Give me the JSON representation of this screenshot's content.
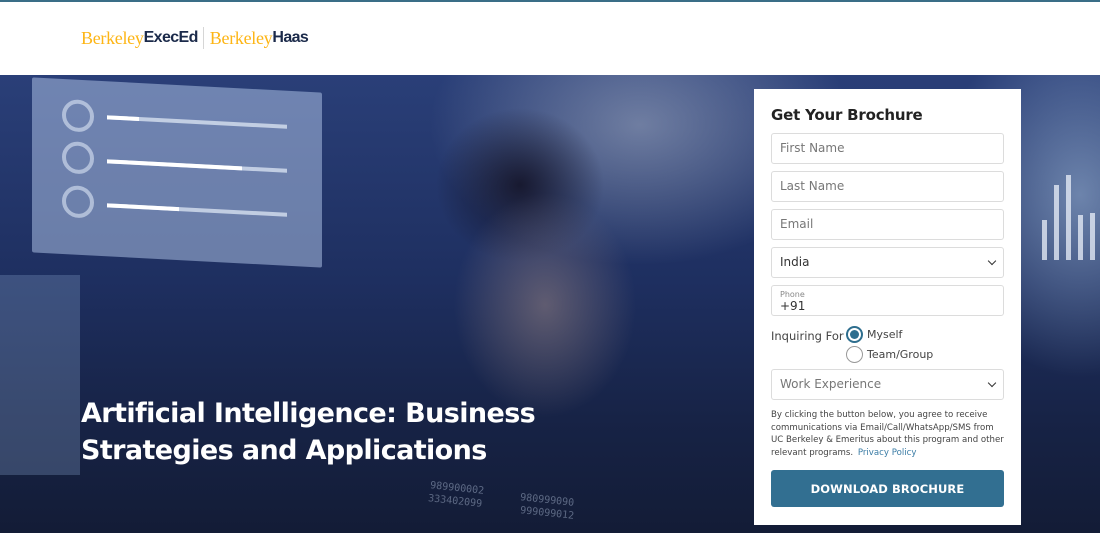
{
  "header": {
    "logo": {
      "part1_serif": "Berkeley",
      "part1_bold": "ExecEd",
      "part2_serif": "Berkeley",
      "part2_bold": "Haas"
    }
  },
  "hero": {
    "title_line1": "Artificial Intelligence: Business",
    "title_line2": "Strategies and Applications",
    "background_numbers": [
      "980999090",
      "999099012",
      "989900002",
      "333402099"
    ]
  },
  "form": {
    "title": "Get Your Brochure",
    "first_name_placeholder": "First Name",
    "last_name_placeholder": "Last Name",
    "email_placeholder": "Email",
    "country_selected": "India",
    "phone_label": "Phone",
    "phone_value": "+91",
    "inquiring_label": "Inquiring For",
    "inquiring_options": [
      {
        "label": "Myself",
        "selected": true
      },
      {
        "label": "Team/Group",
        "selected": false
      }
    ],
    "work_experience_placeholder": "Work Experience",
    "consent_text": "By clicking the button below, you agree to receive communications via Email/Call/WhatsApp/SMS from UC Berkeley & Emeritus about this program and other relevant programs.",
    "privacy_link": "Privacy Policy",
    "submit_label": "DOWNLOAD BROCHURE"
  },
  "colors": {
    "brand_gold": "#fdb515",
    "brand_navy": "#1b2a4a",
    "accent": "#326f91",
    "link": "#3a7ca5"
  }
}
